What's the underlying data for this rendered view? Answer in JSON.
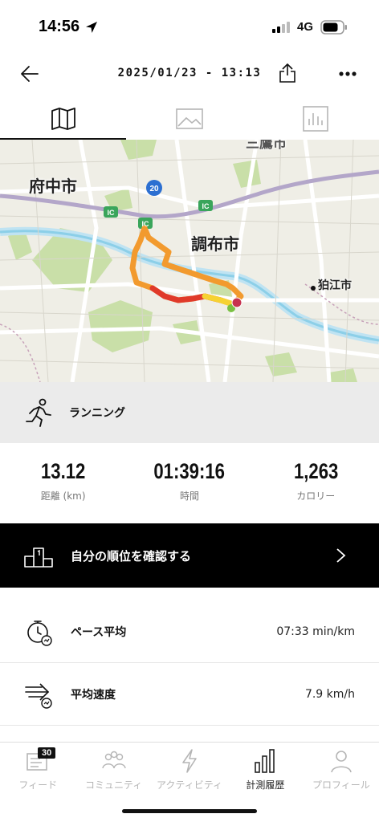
{
  "status_bar": {
    "time": "14:56",
    "network": "4G"
  },
  "header": {
    "title": "2025/01/23 - 13:13"
  },
  "tabs": [
    {
      "name": "map-icon",
      "active": true
    },
    {
      "name": "image-icon",
      "active": false
    },
    {
      "name": "chart-icon",
      "active": false
    }
  ],
  "map": {
    "labels": {
      "fuchu": "府中市",
      "chofu": "調布市",
      "komae": "狛江市",
      "mitaka": "三鷹市"
    },
    "road_shields": {
      "route": "20",
      "ic": "IC"
    }
  },
  "activity": {
    "type": "ランニング"
  },
  "stats": [
    {
      "value": "13.12",
      "unit": "距離 (km)"
    },
    {
      "value": "01:39:16",
      "unit": "時間"
    },
    {
      "value": "1,263",
      "unit": "カロリー"
    }
  ],
  "rank_banner": {
    "label": "自分の順位を確認する"
  },
  "metrics": [
    {
      "label": "ペース平均",
      "value": "07:33 min/km"
    },
    {
      "label": "平均速度",
      "value": "7.9 km/h"
    }
  ],
  "bottom_nav": {
    "badge": "30",
    "items": [
      {
        "label": "フィード",
        "active": false
      },
      {
        "label": "コミュニティ",
        "active": false
      },
      {
        "label": "アクティビティ",
        "active": false
      },
      {
        "label": "計測履歴",
        "active": true
      },
      {
        "label": "プロフィール",
        "active": false
      }
    ]
  }
}
